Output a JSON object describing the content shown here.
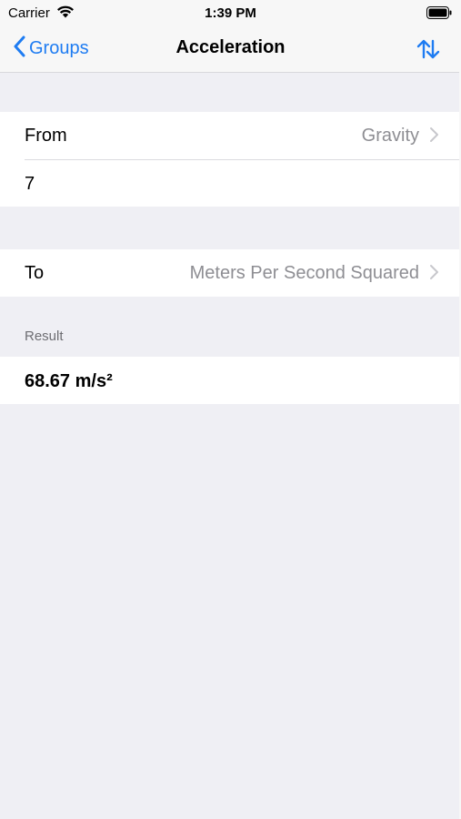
{
  "status_bar": {
    "carrier": "Carrier",
    "time": "1:39 PM",
    "wifi_icon": "wifi-icon",
    "battery_icon": "battery-icon"
  },
  "nav": {
    "back_label": "Groups",
    "title": "Acceleration",
    "swap_icon": "swap-arrows-icon",
    "accent_color": "#1e7cf2"
  },
  "from": {
    "label": "From",
    "unit": "Gravity",
    "input_value": "7"
  },
  "to": {
    "label": "To",
    "unit": "Meters Per Second Squared"
  },
  "result": {
    "header": "Result",
    "value": "68.67 m/s²"
  }
}
